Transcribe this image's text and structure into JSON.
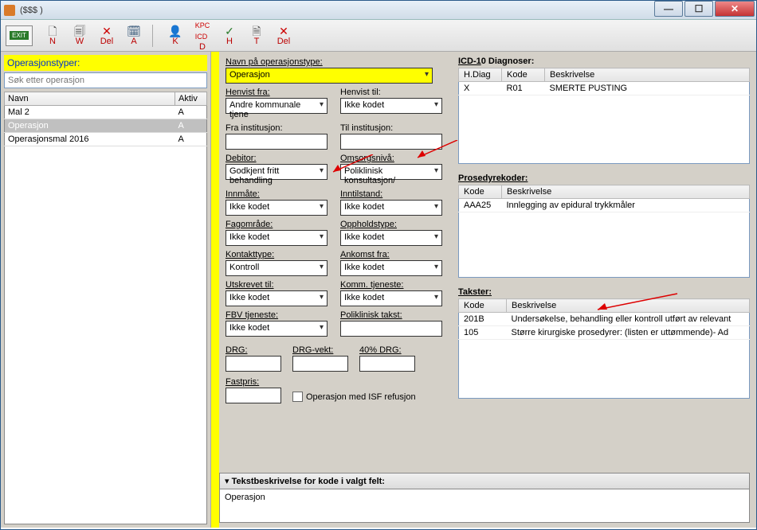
{
  "window": {
    "title": "($$$ )"
  },
  "toolbar": {
    "exit": "EXIT",
    "items": [
      "N",
      "W",
      "Del",
      "A",
      "K",
      "D",
      "H",
      "T",
      "Del"
    ]
  },
  "left": {
    "header": "Operasjonstyper:",
    "search_placeholder": "Søk etter operasjon",
    "col_navn": "Navn",
    "col_aktiv": "Aktiv",
    "rows": [
      {
        "navn": "Mal 2",
        "aktiv": "A"
      },
      {
        "navn": "Operasjon",
        "aktiv": "A"
      },
      {
        "navn": "Operasjonsmal 2016",
        "aktiv": "A"
      }
    ]
  },
  "mid": {
    "name_label": "Navn på operasjonstype:",
    "name_value": "Operasjon",
    "henvist_fra_label": "Henvist fra:",
    "henvist_fra": "Andre kommunale tjene",
    "henvist_til_label": "Henvist til:",
    "henvist_til": "Ikke kodet",
    "fra_inst_label": "Fra institusjon:",
    "fra_inst": "",
    "til_inst_label": "Til institusjon:",
    "til_inst": "",
    "debitor_label": "Debitor:",
    "debitor": "Godkjent fritt behandling",
    "omsorg_label": "Omsorgsnivå:",
    "omsorg": "Poliklinisk konsultasjon/",
    "innmate_label": "Innmåte:",
    "innmate": "Ikke kodet",
    "inntilstand_label": "Inntilstand:",
    "inntilstand": "Ikke kodet",
    "fagomrade_label": "Fagområde:",
    "fagomrade": "Ikke kodet",
    "oppholdstype_label": "Oppholdstype:",
    "oppholdstype": "Ikke kodet",
    "kontakttype_label": "Kontakttype:",
    "kontakttype": "Kontroll",
    "ankomst_label": "Ankomst fra:",
    "ankomst": "Ikke kodet",
    "utskrevet_label": "Utskrevet til:",
    "utskrevet": "Ikke kodet",
    "komm_label": "Komm. tjeneste:",
    "komm": "Ikke kodet",
    "fbv_label": "FBV tjeneste:",
    "fbv": "Ikke kodet",
    "poli_takst_label": "Poliklinisk takst:",
    "poli_takst": "",
    "drg_label": "DRG:",
    "drg_vekt_label": "DRG-vekt:",
    "drg40_label": "40% DRG:",
    "fastpris_label": "Fastpris:",
    "isf_label": "Operasjon med ISF refusjon"
  },
  "icd": {
    "title": "ICD-10 Diagnoser:",
    "col_hdiag": "H.Diag",
    "col_kode": "Kode",
    "col_beskr": "Beskrivelse",
    "rows": [
      {
        "hdiag": "X",
        "kode": "R01",
        "beskr": "SMERTE PUSTING"
      }
    ]
  },
  "pros": {
    "title": "Prosedyrekoder:",
    "col_kode": "Kode",
    "col_beskr": "Beskrivelse",
    "rows": [
      {
        "kode": "AAA25",
        "beskr": "Innlegging av epidural trykkmåler"
      }
    ]
  },
  "takst": {
    "title": "Takster:",
    "col_kode": "Kode",
    "col_beskr": "Beskrivelse",
    "rows": [
      {
        "kode": "201B",
        "beskr": "Undersøkelse, behandling eller kontroll utført av relevant"
      },
      {
        "kode": "105",
        "beskr": "Større kirurgiske prosedyrer: (listen er uttømmende)- Ad"
      }
    ]
  },
  "desc": {
    "header": "Tekstbeskrivelse for kode i valgt felt:",
    "body": "Operasjon"
  }
}
